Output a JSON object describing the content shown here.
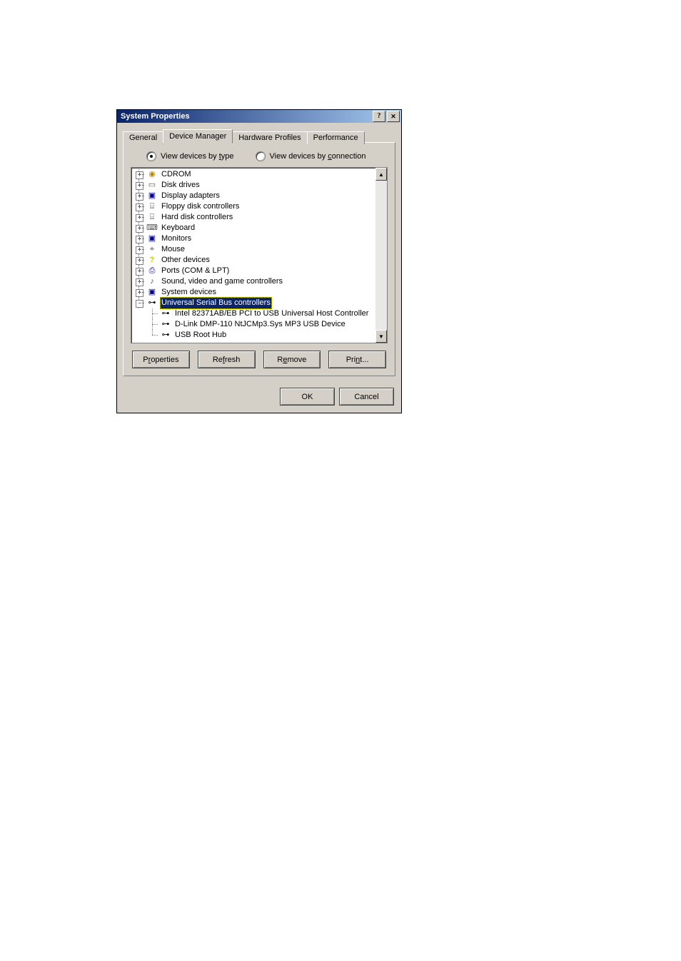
{
  "window": {
    "title": "System Properties"
  },
  "tabs": {
    "general": "General",
    "device_manager": "Device Manager",
    "hardware_profiles": "Hardware Profiles",
    "performance": "Performance",
    "active": "device_manager"
  },
  "radios": {
    "by_type_pre": "View devices by ",
    "by_type_u": "t",
    "by_type_post": "ype",
    "by_conn_pre": "View devices by ",
    "by_conn_u": "c",
    "by_conn_post": "onnection",
    "checked": "type"
  },
  "tree": [
    {
      "expand": "+",
      "icon": "cd",
      "label": "CDROM"
    },
    {
      "expand": "+",
      "icon": "disk",
      "label": "Disk drives"
    },
    {
      "expand": "+",
      "icon": "display",
      "label": "Display adapters"
    },
    {
      "expand": "+",
      "icon": "floppy",
      "label": "Floppy disk controllers"
    },
    {
      "expand": "+",
      "icon": "hd",
      "label": "Hard disk controllers"
    },
    {
      "expand": "+",
      "icon": "keyboard",
      "label": "Keyboard"
    },
    {
      "expand": "+",
      "icon": "monitor",
      "label": "Monitors"
    },
    {
      "expand": "+",
      "icon": "mouse",
      "label": "Mouse"
    },
    {
      "expand": "+",
      "icon": "other",
      "label": "Other devices"
    },
    {
      "expand": "+",
      "icon": "ports",
      "label": "Ports (COM & LPT)"
    },
    {
      "expand": "+",
      "icon": "sound",
      "label": "Sound, video and game controllers"
    },
    {
      "expand": "+",
      "icon": "system",
      "label": "System devices"
    },
    {
      "expand": "-",
      "icon": "usb",
      "label": "Universal Serial Bus controllers",
      "selected": true,
      "children": [
        {
          "icon": "usb",
          "label": "Intel 82371AB/EB PCI to USB Universal Host Controller"
        },
        {
          "icon": "usb",
          "label": "D-Link DMP-110  NtJCMp3.Sys  MP3 USB Device"
        },
        {
          "icon": "usb",
          "label": "USB Root Hub",
          "last": true
        }
      ]
    }
  ],
  "buttons": {
    "properties_pre": "P",
    "properties_u": "r",
    "properties_post": "operties",
    "refresh_pre": "Re",
    "refresh_u": "f",
    "refresh_post": "resh",
    "remove_pre": "R",
    "remove_u": "e",
    "remove_post": "move",
    "print_pre": "Pri",
    "print_u": "n",
    "print_post": "t...",
    "ok": "OK",
    "cancel": "Cancel"
  },
  "icon_glyphs": {
    "cd": "◉",
    "disk": "▭",
    "display": "▣",
    "floppy": "⌸",
    "hd": "⌸",
    "keyboard": "⌨",
    "monitor": "▣",
    "mouse": "⌖",
    "other": "?",
    "ports": "⎙",
    "sound": "♪",
    "system": "▣",
    "usb": "⊶"
  }
}
